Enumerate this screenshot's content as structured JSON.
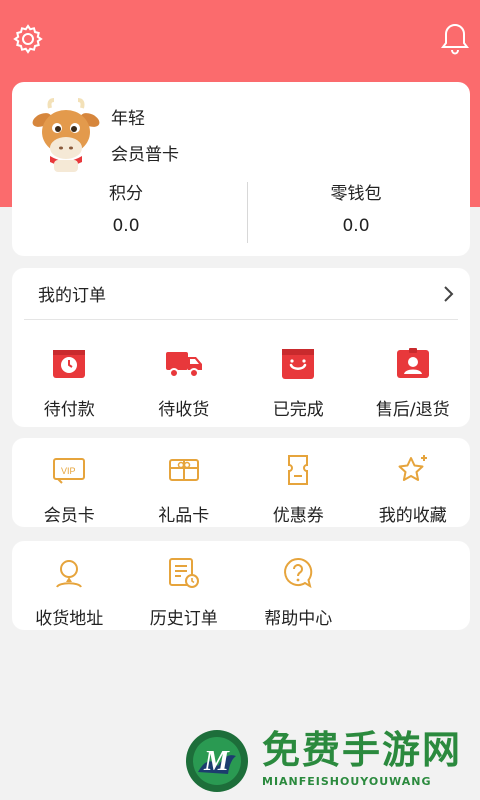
{
  "header": {
    "settings_icon": "gear-icon",
    "notification_icon": "bell-icon",
    "bg_color": "#fb6b6d"
  },
  "profile": {
    "username": "年轻",
    "member_level": "会员普卡",
    "points_label": "积分",
    "points_value": "0.0",
    "wallet_label": "零钱包",
    "wallet_value": "0.0"
  },
  "orders": {
    "title": "我的订单",
    "items": [
      {
        "label": "待付款",
        "icon": "clock-icon"
      },
      {
        "label": "待收货",
        "icon": "truck-icon"
      },
      {
        "label": "已完成",
        "icon": "smile-box-icon"
      },
      {
        "label": "售后/退货",
        "icon": "id-badge-icon"
      }
    ]
  },
  "services": {
    "items": [
      {
        "label": "会员卡",
        "icon": "vip-card-icon"
      },
      {
        "label": "礼品卡",
        "icon": "gift-card-icon"
      },
      {
        "label": "优惠券",
        "icon": "ticket-icon"
      },
      {
        "label": "我的收藏",
        "icon": "star-icon"
      }
    ]
  },
  "tools": {
    "items": [
      {
        "label": "收货地址",
        "icon": "location-person-icon"
      },
      {
        "label": "历史订单",
        "icon": "history-list-icon"
      },
      {
        "label": "帮助中心",
        "icon": "help-icon"
      }
    ]
  },
  "watermark": {
    "title": "免费手游网",
    "subtitle": "MIANFEISHOUYOUWANG"
  },
  "colors": {
    "accent_red": "#e8383b",
    "accent_orange": "#e6a43c",
    "brand_green": "#2b8a3e"
  }
}
